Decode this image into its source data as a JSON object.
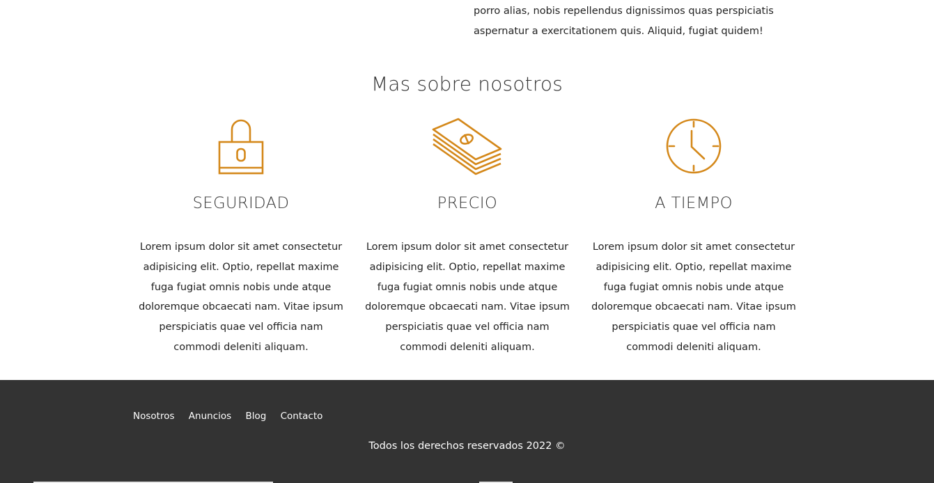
{
  "intro": {
    "text": "porro alias, nobis repellendus dignissimos quas perspiciatis aspernatur a exercitationem quis. Aliquid, fugiat quidem!"
  },
  "about": {
    "title": "Mas sobre nosotros",
    "accent_color": "#d4881a",
    "features": [
      {
        "icon": "padlock-icon",
        "title": "SEGURIDAD",
        "text": "Lorem ipsum dolor sit amet consectetur adipisicing elit. Optio, repellat maxime fuga fugiat omnis nobis unde atque doloremque obcaecati nam. Vitae ipsum perspiciatis quae vel officia nam commodi deleniti aliquam."
      },
      {
        "icon": "money-stack-icon",
        "title": "PRECIO",
        "text": "Lorem ipsum dolor sit amet consectetur adipisicing elit. Optio, repellat maxime fuga fugiat omnis nobis unde atque doloremque obcaecati nam. Vitae ipsum perspiciatis quae vel officia nam commodi deleniti aliquam."
      },
      {
        "icon": "clock-icon",
        "title": "A TIEMPO",
        "text": "Lorem ipsum dolor sit amet consectetur adipisicing elit. Optio, repellat maxime fuga fugiat omnis nobis unde atque doloremque obcaecati nam. Vitae ipsum perspiciatis quae vel officia nam commodi deleniti aliquam."
      }
    ]
  },
  "footer": {
    "background": "#333333",
    "nav": [
      "Nosotros",
      "Anuncios",
      "Blog",
      "Contacto"
    ],
    "copyright": "Todos los derechos reservados 2022 ©"
  }
}
